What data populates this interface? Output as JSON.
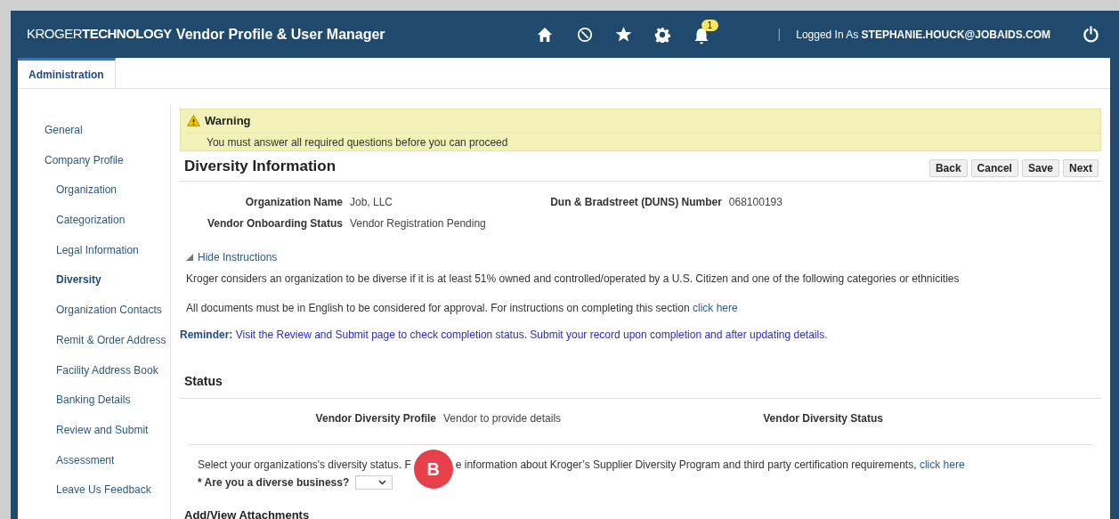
{
  "header": {
    "logo_light": "KROGER",
    "logo_bold": "TECHNOLOGY",
    "app_title": "Vendor Profile & User Manager",
    "notification_count": "1",
    "separator": "|",
    "logged_in_label": "Logged In As",
    "user": "STEPHANIE.HOUCK@JOBAIDS.COM"
  },
  "tabs": [
    {
      "label": "Administration",
      "selected": true
    }
  ],
  "sidebar": {
    "items": [
      {
        "label": "General",
        "selected": false
      },
      {
        "label": "Company Profile",
        "selected": false,
        "children": [
          {
            "label": "Organization",
            "selected": false
          },
          {
            "label": "Categorization",
            "selected": false
          },
          {
            "label": "Legal Information",
            "selected": false
          },
          {
            "label": "Diversity",
            "selected": true
          },
          {
            "label": "Organization Contacts",
            "selected": false
          },
          {
            "label": "Remit & Order Address",
            "selected": false
          },
          {
            "label": "Facility Address Book",
            "selected": false
          },
          {
            "label": "Banking Details",
            "selected": false
          },
          {
            "label": "Review and Submit",
            "selected": false
          },
          {
            "label": "Assessment",
            "selected": false
          },
          {
            "label": "Leave Us Feedback",
            "selected": false
          }
        ]
      }
    ]
  },
  "warning": {
    "title": "Warning",
    "message": "You must answer all required questions before you can proceed"
  },
  "page_title": "Diversity Information",
  "buttons": [
    "Back",
    "Cancel",
    "Save",
    "Next"
  ],
  "fields": [
    {
      "label": "Organization Name",
      "value": "Job, LLC"
    },
    {
      "label": "Dun & Bradstreet (DUNS) Number",
      "value": "068100193"
    },
    {
      "label": "Vendor Onboarding Status",
      "value": "Vendor Registration Pending"
    }
  ],
  "instructions": {
    "toggle": "Hide Instructions",
    "expanded": true,
    "paragraphs": [
      {
        "text": "Kroger considers an organization to be diverse if it is at least 51% owned and controlled/operated by a U.S. Citizen and one of the following categories or ethnicities"
      },
      {
        "text": "All documents must be in English to be considered for approval. For instructions on completing this section",
        "link": "click here"
      }
    ]
  },
  "reminder": "**Reminder:** Visit the Review and Submit page to check completion status. Submit your record upon completion and after updating details.",
  "status": {
    "title": "Status",
    "fields": [
      {
        "label": "Vendor Diversity Profile",
        "value": "Vendor to provide details"
      },
      {
        "label": "Vendor Diversity Status"
      }
    ]
  },
  "diversity": {
    "text_before": "Select your organizations's diversity status. F",
    "text_after": "e information about Kroger’s Supplier Diversity Program and third party certification requirements,",
    "link": "click here",
    "question": "* Are you a diverse business?",
    "callout": "B"
  },
  "attachments_title": "Add/View Attachments"
}
